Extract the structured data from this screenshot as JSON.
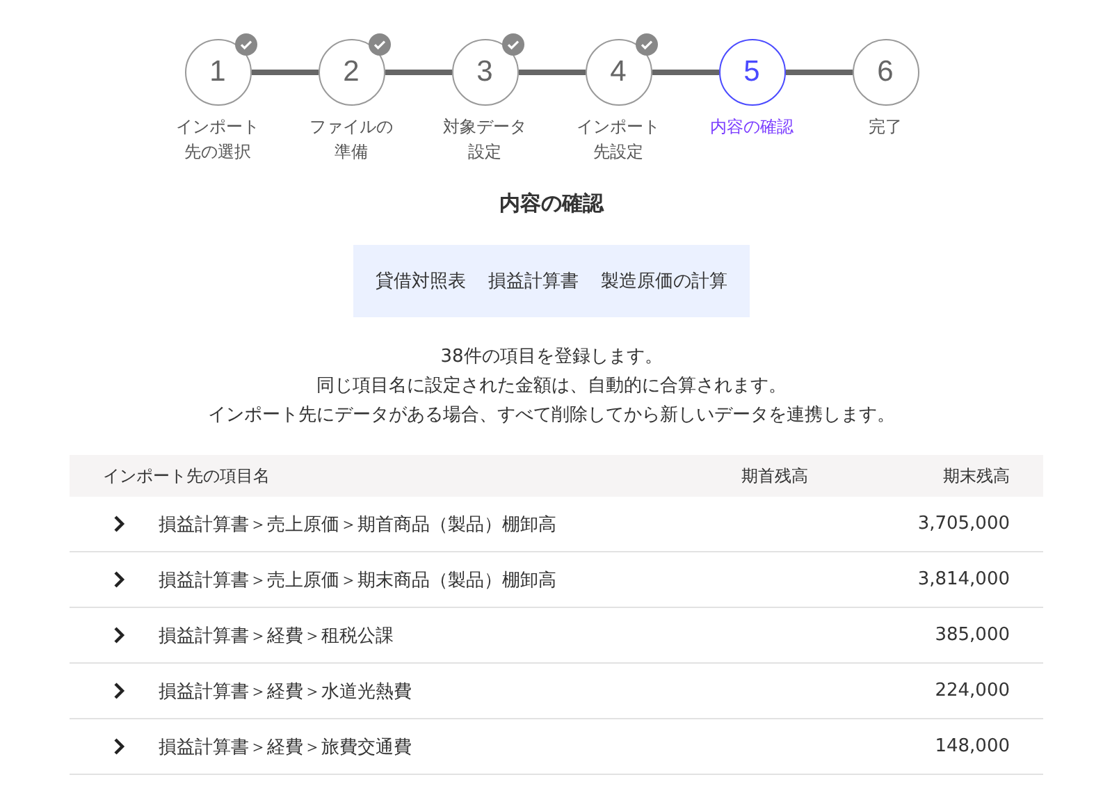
{
  "steps": [
    {
      "number": "1",
      "label_lines": [
        "インポート",
        "先の選択"
      ],
      "completed": true,
      "selected": false
    },
    {
      "number": "2",
      "label_lines": [
        "ファイルの",
        "準備"
      ],
      "completed": true,
      "selected": false
    },
    {
      "number": "3",
      "label_lines": [
        "対象データ",
        "設定"
      ],
      "completed": true,
      "selected": false
    },
    {
      "number": "4",
      "label_lines": [
        "インポート",
        "先設定"
      ],
      "completed": true,
      "selected": false
    },
    {
      "number": "5",
      "label_lines": [
        "内容の確認"
      ],
      "completed": false,
      "selected": true
    },
    {
      "number": "6",
      "label_lines": [
        "完了"
      ],
      "completed": false,
      "selected": false
    }
  ],
  "heading": "内容の確認",
  "categories": [
    "貸借対照表",
    "損益計算書",
    "製造原価の計算"
  ],
  "messages": [
    "38件の項目を登録します。",
    "同じ項目名に設定された金額は、自動的に合算されます。",
    "インポート先にデータがある場合、すべて削除してから新しいデータを連携します。"
  ],
  "table": {
    "columns": [
      "インポート先の項目名",
      "期首残高",
      "期末残高"
    ],
    "rows": [
      {
        "name": "損益計算書＞売上原価＞期首商品（製品）棚卸高",
        "closing": "3,705,000"
      },
      {
        "name": "損益計算書＞売上原価＞期末商品（製品）棚卸高",
        "closing": "3,814,000"
      },
      {
        "name": "損益計算書＞経費＞租税公課",
        "closing": "385,000"
      },
      {
        "name": "損益計算書＞経費＞水道光熱費",
        "closing": "224,000"
      },
      {
        "name": "損益計算書＞経費＞旅費交通費",
        "closing": "148,000"
      }
    ]
  }
}
